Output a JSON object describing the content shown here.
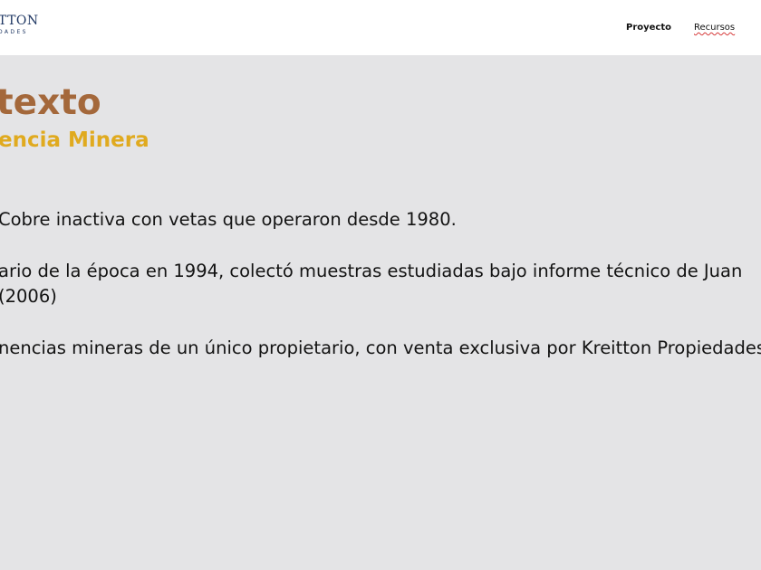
{
  "header": {
    "logo": {
      "wordmark": "TTON",
      "tagline": "DADES"
    },
    "nav": [
      {
        "label": "Proyecto"
      },
      {
        "label": "Recursos"
      }
    ]
  },
  "main": {
    "title": "texto",
    "subtitle": "encia Minera",
    "paragraphs": [
      "Cobre inactiva con vetas que operaron  desde 1980.",
      "ario de la época en 1994, colectó muestras estudiadas bajo informe técnico de Juan",
      "(2006)",
      "nencias mineras de un único propietario, con venta exclusiva por Kreitton Propiedades"
    ]
  },
  "colors": {
    "header_background": "#ffffff",
    "page_background": "#e4e4e6",
    "logo": "#1f3763",
    "title": "#a4683b",
    "subtitle": "#e0aa1f",
    "body_text": "#131313",
    "spellcheck_underline": "#d63a3a"
  }
}
